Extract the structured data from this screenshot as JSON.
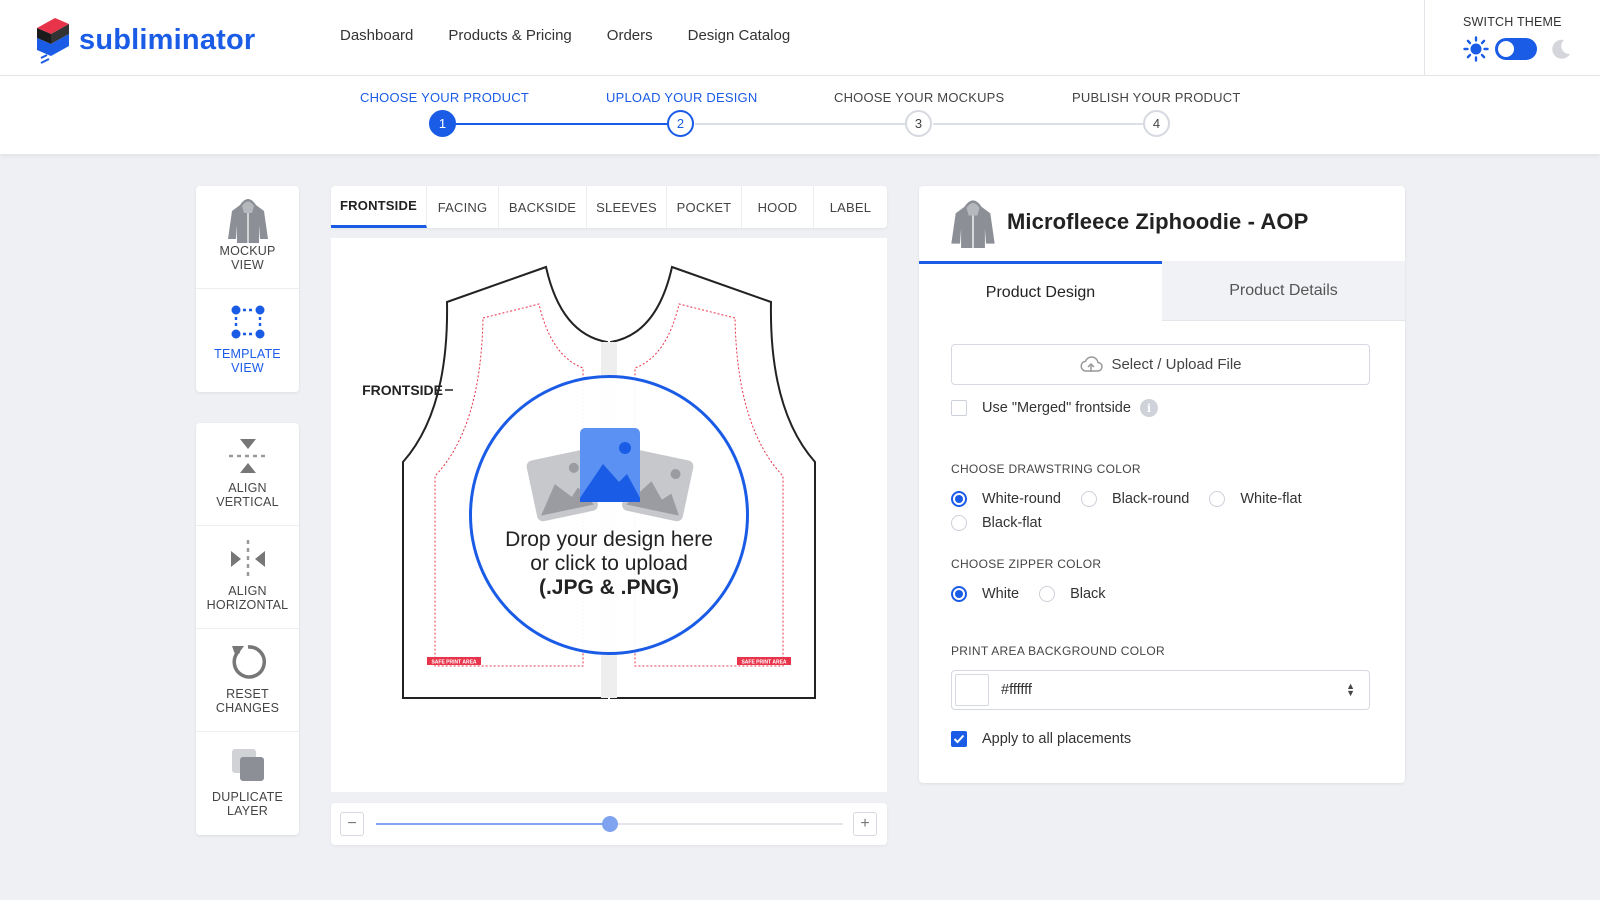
{
  "brand": {
    "name": "subliminator",
    "accent": "#1a5ce6",
    "logo_red": "#e8344a"
  },
  "nav": {
    "items": [
      "Dashboard",
      "Products & Pricing",
      "Orders",
      "Design Catalog"
    ]
  },
  "theme": {
    "label": "SWITCH THEME",
    "sun_icon": "sun-icon",
    "moon_icon": "moon-icon"
  },
  "steps": [
    {
      "label": "CHOOSE YOUR PRODUCT",
      "num": "1",
      "state": "done"
    },
    {
      "label": "UPLOAD YOUR DESIGN",
      "num": "2",
      "state": "current"
    },
    {
      "label": "CHOOSE YOUR MOCKUPS",
      "num": "3",
      "state": "todo"
    },
    {
      "label": "PUBLISH YOUR PRODUCT",
      "num": "4",
      "state": "todo"
    }
  ],
  "view_tools": [
    {
      "line1": "MOCKUP",
      "line2": "VIEW",
      "icon": "hoodie-icon",
      "active": false
    },
    {
      "line1": "TEMPLATE",
      "line2": "VIEW",
      "icon": "template-icon",
      "active": true
    }
  ],
  "edit_tools": [
    {
      "line1": "ALIGN",
      "line2": "VERTICAL",
      "icon": "align-vertical-icon"
    },
    {
      "line1": "ALIGN",
      "line2": "HORIZONTAL",
      "icon": "align-horizontal-icon"
    },
    {
      "line1": "RESET",
      "line2": "CHANGES",
      "icon": "reset-icon"
    },
    {
      "line1": "DUPLICATE",
      "line2": "LAYER",
      "icon": "duplicate-icon"
    }
  ],
  "placement_tabs": [
    "FRONTSIDE",
    "FACING",
    "BACKSIDE",
    "SLEEVES",
    "POCKET",
    "HOOD",
    "LABEL"
  ],
  "active_tab": "FRONTSIDE",
  "canvas": {
    "placement_label": "FRONTSIDE",
    "drop_line1": "Drop your design here",
    "drop_line2": "or click to upload",
    "drop_line3": "(.JPG & .PNG)",
    "safe_area_label": "SAFE PRINT AREA"
  },
  "zoom": {
    "minus": "−",
    "plus": "+",
    "level": 0.5
  },
  "product": {
    "title": "Microfleece Ziphoodie - AOP",
    "tabs": [
      "Product Design",
      "Product Details"
    ],
    "active_tab": "Product Design",
    "upload_label": "Select / Upload File",
    "merged_label": "Use \"Merged\" frontside",
    "merged_checked": false,
    "info_glyph": "i",
    "drawstring_title": "CHOOSE DRAWSTRING COLOR",
    "drawstring_options": [
      "White-round",
      "Black-round",
      "White-flat",
      "Black-flat"
    ],
    "drawstring_selected": "White-round",
    "zipper_title": "CHOOSE ZIPPER COLOR",
    "zipper_options": [
      "White",
      "Black"
    ],
    "zipper_selected": "White",
    "bg_title": "PRINT AREA BACKGROUND COLOR",
    "bg_value": "#ffffff",
    "apply_label": "Apply to all placements",
    "apply_checked": true
  }
}
